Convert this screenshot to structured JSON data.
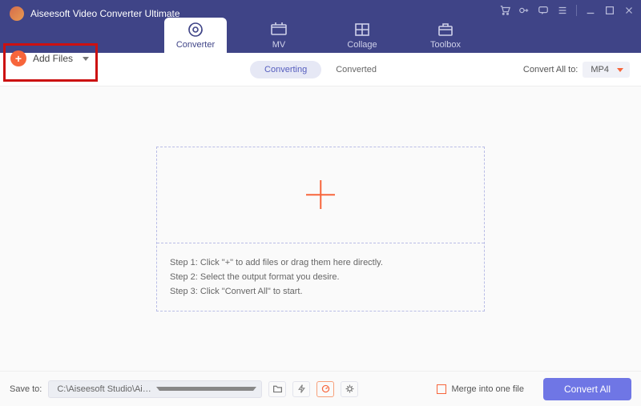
{
  "app": {
    "title": "Aiseesoft Video Converter Ultimate"
  },
  "nav": {
    "converter": "Converter",
    "mv": "MV",
    "collage": "Collage",
    "toolbox": "Toolbox"
  },
  "toolbar": {
    "add_files": "Add Files",
    "seg_converting": "Converting",
    "seg_converted": "Converted",
    "convert_all_to_label": "Convert All to:",
    "format_selected": "MP4"
  },
  "dropzone": {
    "step1": "Step 1: Click \"+\" to add files or drag them here directly.",
    "step2": "Step 2: Select the output format you desire.",
    "step3": "Step 3: Click \"Convert All\" to start."
  },
  "footer": {
    "save_to_label": "Save to:",
    "save_path": "C:\\Aiseesoft Studio\\Ais...rter Ultimate\\Converted",
    "merge_label": "Merge into one file",
    "convert_all": "Convert All"
  }
}
